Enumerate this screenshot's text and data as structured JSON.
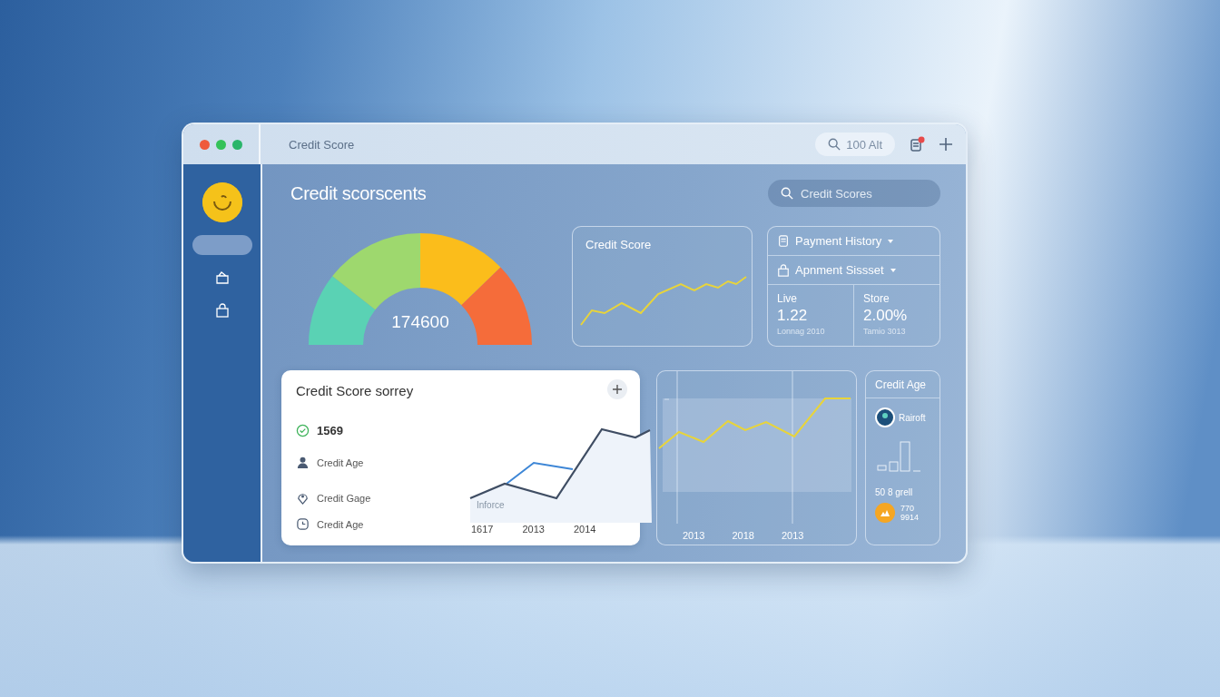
{
  "window": {
    "title": "Credit Score",
    "search": "100 Alt"
  },
  "sidebar": {
    "items": [
      {
        "kind": "blank",
        "selected": true
      },
      {
        "kind": "card",
        "selected": false
      },
      {
        "kind": "lock",
        "selected": false
      }
    ]
  },
  "main": {
    "heading": "Credit scorscents",
    "search": {
      "placeholder": "Credit Scores"
    },
    "gauge": {
      "value": "174600"
    },
    "score_card": {
      "title": "Credit Score"
    },
    "payment_card": {
      "rows": [
        {
          "kind": "receipt",
          "label": "Payment History"
        },
        {
          "kind": "lock",
          "label": "Apnment Sissset"
        }
      ],
      "stats": [
        {
          "label": "Live",
          "value": "1.22",
          "note": "Lonnag 2010"
        },
        {
          "label": "Store",
          "value": "2.00%",
          "note": "Tamio 3013"
        }
      ]
    },
    "summary_card": {
      "title": "Credit Score sorrey",
      "items": [
        {
          "kind": "check",
          "text": "1569"
        },
        {
          "kind": "person",
          "text": "Credit Age"
        },
        {
          "kind": "pin",
          "text": "Credit Gage"
        },
        {
          "kind": "clock",
          "text": "Credit Age"
        }
      ],
      "chart_label": "Inforce",
      "x_labels": [
        "1617",
        "2013",
        "2014"
      ]
    },
    "trend_card": {
      "x_labels": [
        "2013",
        "2018",
        "2013"
      ]
    },
    "age_card": {
      "title": "Credit Age",
      "avatar_label": "Rairoft",
      "caption": "50 8 grell",
      "badge_lines": [
        "770",
        "9914"
      ]
    }
  }
}
